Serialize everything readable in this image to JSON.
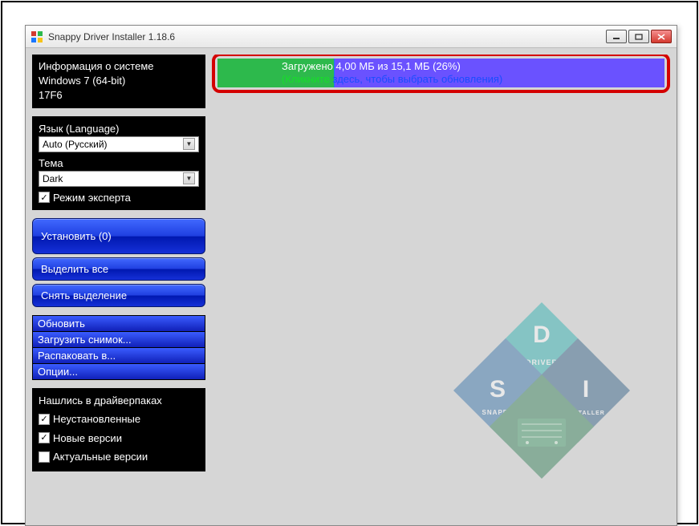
{
  "window": {
    "title": "Snappy Driver Installer 1.18.6"
  },
  "sysinfo": {
    "title": "Информация о системе",
    "os": "Windows 7 (64-bit)",
    "code": "17F6"
  },
  "settings": {
    "language_label": "Язык (Language)",
    "language_value": "Auto (Русский)",
    "theme_label": "Тема",
    "theme_value": "Dark",
    "expert_label": "Режим эксперта",
    "expert_checked": true
  },
  "actions": {
    "install": "Установить (0)",
    "select_all": "Выделить все",
    "deselect": "Снять выделение"
  },
  "ops": {
    "update": "Обновить",
    "download_snapshot": "Загрузить снимок...",
    "unpack_to": "Распаковать в...",
    "options": "Опции..."
  },
  "filters": {
    "title": "Нашлись в драйверпаках",
    "not_installed": "Неустановленные",
    "not_installed_checked": true,
    "new_versions": "Новые версии",
    "new_versions_checked": true,
    "current_versions": "Актуальные версии",
    "current_versions_checked": false
  },
  "progress": {
    "percent": 26,
    "line1": "Загружено 4,00 МБ из 15,1 МБ (26%)",
    "line2_prefix": "(Кликните ",
    "line2_rest": "здесь, чтобы выбрать обновления)"
  },
  "logo": {
    "top": "DRIVER",
    "left": "SNAPPY",
    "right": "INSTALLER",
    "letter_s": "S",
    "letter_d": "D",
    "letter_i": "I"
  }
}
